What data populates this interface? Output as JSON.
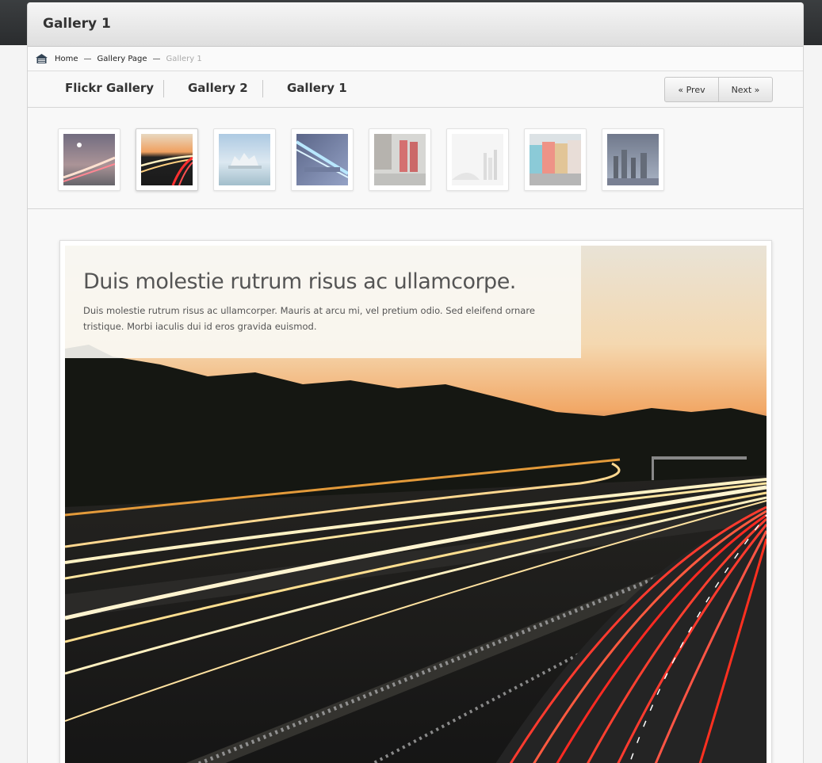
{
  "page": {
    "title": "Gallery 1"
  },
  "breadcrumb": {
    "home_icon": "home-icon",
    "items": [
      {
        "label": "Home"
      },
      {
        "label": "Gallery Page"
      },
      {
        "label": "Gallery 1"
      }
    ],
    "separator": "—"
  },
  "tabs": [
    {
      "label": "Flickr Gallery"
    },
    {
      "label": "Gallery 2"
    },
    {
      "label": "Gallery 1"
    }
  ],
  "pager": {
    "prev_label": "« Prev",
    "next_label": "Next »"
  },
  "thumbnails": [
    {
      "subject": "night-highway-light-trails",
      "active": false
    },
    {
      "subject": "sunset-highway-light-trails",
      "active": true
    },
    {
      "subject": "city-on-water",
      "active": false
    },
    {
      "subject": "blue-light-tunnel-bridge",
      "active": false
    },
    {
      "subject": "red-telephone-boxes",
      "active": false
    },
    {
      "subject": "foggy-city-skyline",
      "active": false
    },
    {
      "subject": "colorful-houses-street",
      "active": false
    },
    {
      "subject": "city-skyline-dusk",
      "active": false
    }
  ],
  "slide": {
    "heading": "Duis molestie rutrum risus ac ullamcorpe.",
    "text": "Duis molestie rutrum risus ac ullamcorper. Mauris at arcu mi, vel pretium odio. Sed eleifend ornare tristique. Morbi iaculis dui id eros gravida euismod.",
    "image": "sunset-highway-light-trails"
  },
  "colors": {
    "topbar": "#2f3133",
    "text": "#333333",
    "muted": "#aaaaaa",
    "sky_top": "#e9e3d6",
    "sky_horizon": "#f2a867",
    "trail_white": "#fff2c4",
    "trail_red": "#ff3b2f"
  }
}
